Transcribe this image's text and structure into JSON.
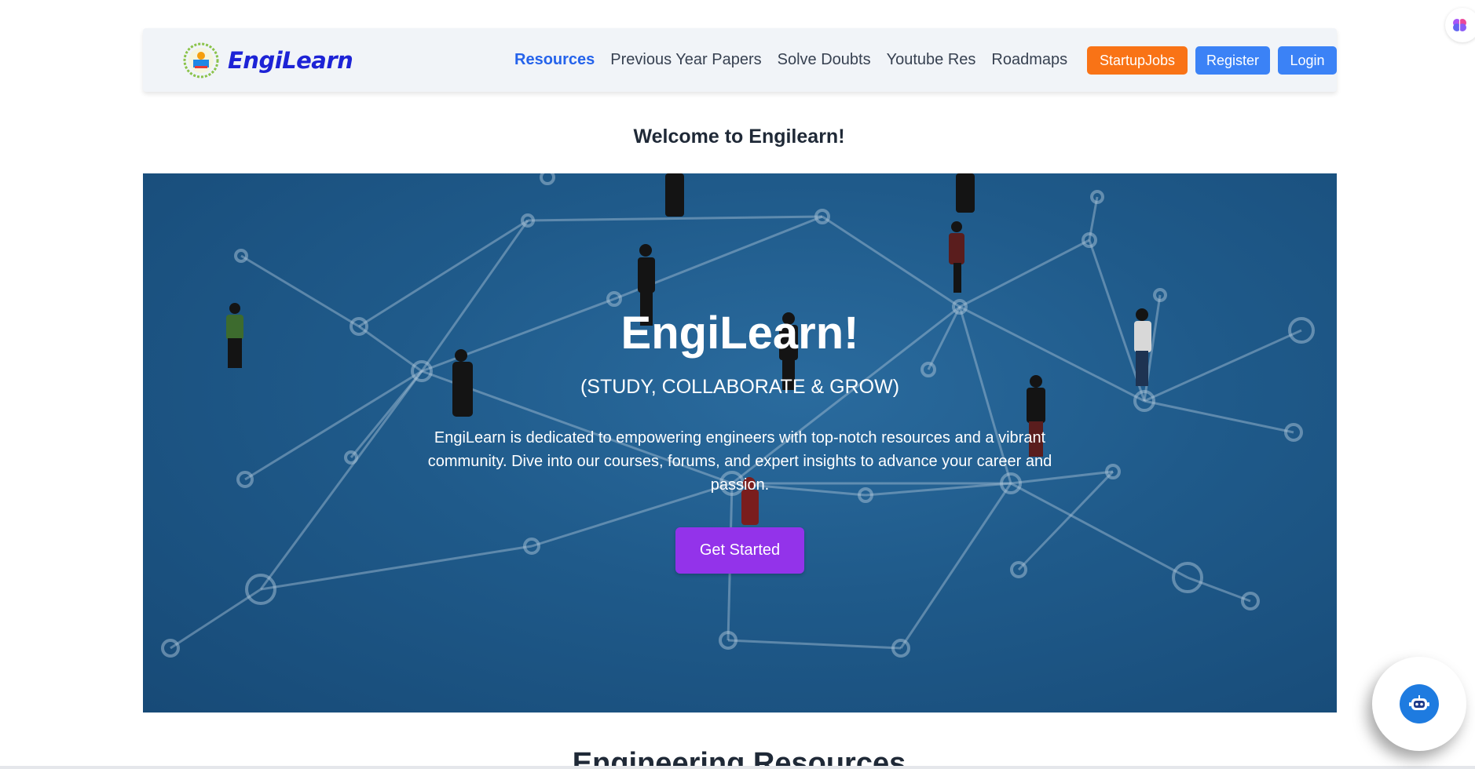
{
  "brand": {
    "name": "EngiLearn"
  },
  "nav": {
    "links": [
      {
        "label": "Resources",
        "active": true
      },
      {
        "label": "Previous Year Papers"
      },
      {
        "label": "Solve Doubts"
      },
      {
        "label": "Youtube Res"
      },
      {
        "label": "Roadmaps"
      }
    ],
    "buttons": {
      "startup": "StartupJobs",
      "register": "Register",
      "login": "Login"
    }
  },
  "welcome": "Welcome to Engilearn!",
  "hero": {
    "title": "EngiLearn!",
    "subtitle": "(STUDY, COLLABORATE & GROW)",
    "description": "EngiLearn is dedicated to empowering engineers with top-notch resources and a vibrant community. Dive into our courses, forums, and expert insights to advance your career and passion.",
    "cta": "Get Started"
  },
  "section": {
    "heading": "Engineering Resources"
  },
  "icons": {
    "logo": "engilearn-logo-icon",
    "chatbot": "robot-icon",
    "extension": "brain-icon"
  },
  "colors": {
    "brand": "#1d23d6",
    "active_link": "#2563eb",
    "startup_button": "#f97316",
    "primary_button": "#3b82f6",
    "cta_button": "#9333ea",
    "hero_bg": "#1f5a8a"
  }
}
